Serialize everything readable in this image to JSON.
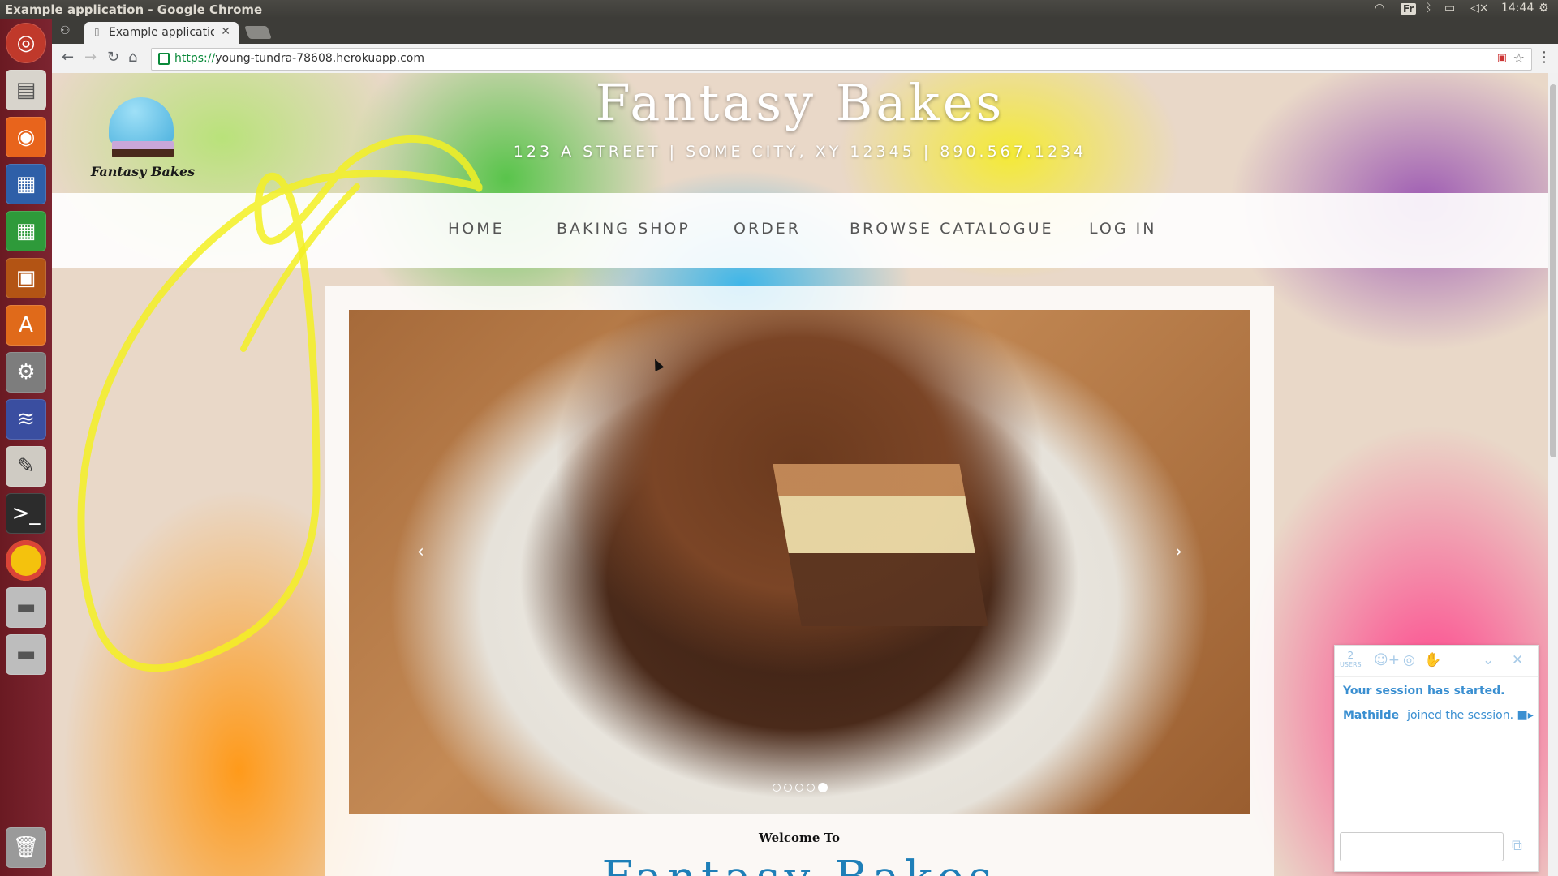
{
  "topbar": {
    "window_title": "Example application - Google Chrome",
    "clock": "14:44",
    "keyboard": "Fr"
  },
  "browser": {
    "tab_title": "Example application",
    "url_secure": "https://",
    "url_host": "young-tundra-78608.herokuapp.com"
  },
  "site": {
    "title": "Fantasy Bakes",
    "logo_text": "Fantasy Bakes",
    "address": "123 A STREET | SOME CITY, XY 12345 | 890.567.1234",
    "nav": [
      "HOME",
      "BAKING SHOP",
      "ORDER",
      "BROWSE CATALOGUE",
      "LOG IN"
    ],
    "carousel": {
      "prev": "‹",
      "next": "›",
      "slides": 5,
      "active": 5
    },
    "welcome": "Welcome To",
    "welcome_title": "Fantasy Bakes"
  },
  "chat": {
    "users_count": "2",
    "users_label": "USERS",
    "session_started": "Your session has started.",
    "joined_user": "Mathilde",
    "joined_text": "joined the session.",
    "input_value": ""
  },
  "colors": {
    "launcher": "#7c2430",
    "accent_blue": "#3a8fd1",
    "scribble": "#f3f023"
  }
}
